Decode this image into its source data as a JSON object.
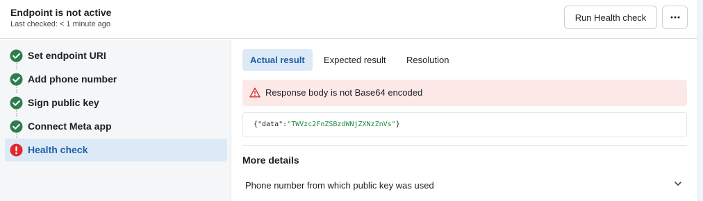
{
  "header": {
    "title": "Endpoint is not active",
    "last_checked": "Last checked: < 1 minute ago",
    "run_button_label": "Run Health check",
    "more_icon": "ellipsis-icon"
  },
  "sidebar": {
    "steps": [
      {
        "label": "Set endpoint URI",
        "status": "complete",
        "icon": "check-circle-icon"
      },
      {
        "label": "Add phone number",
        "status": "complete",
        "icon": "check-circle-icon"
      },
      {
        "label": "Sign public key",
        "status": "complete",
        "icon": "check-circle-icon"
      },
      {
        "label": "Connect Meta app",
        "status": "complete",
        "icon": "check-circle-icon"
      },
      {
        "label": "Health check",
        "status": "error",
        "icon": "error-circle-icon",
        "active": true
      }
    ]
  },
  "tabs": [
    {
      "label": "Actual result",
      "active": true
    },
    {
      "label": "Expected result",
      "active": false
    },
    {
      "label": "Resolution",
      "active": false
    }
  ],
  "error": {
    "icon": "warning-triangle-icon",
    "message": "Response body is not Base64 encoded"
  },
  "code": {
    "open": "{",
    "key": "\"data\"",
    "sep": ":",
    "value": "\"TWVzc2FnZSBzdWNjZXNzZnVs\"",
    "close": "}"
  },
  "details": {
    "title": "More details",
    "row_label": "Phone number from which public key was used",
    "row_icon": "chevron-down-icon"
  },
  "colors": {
    "success": "#2e7d50",
    "error": "#e0282e",
    "accent": "#1d5ea8",
    "active_bg": "#dceaf7",
    "error_bg": "#fde8e8"
  }
}
